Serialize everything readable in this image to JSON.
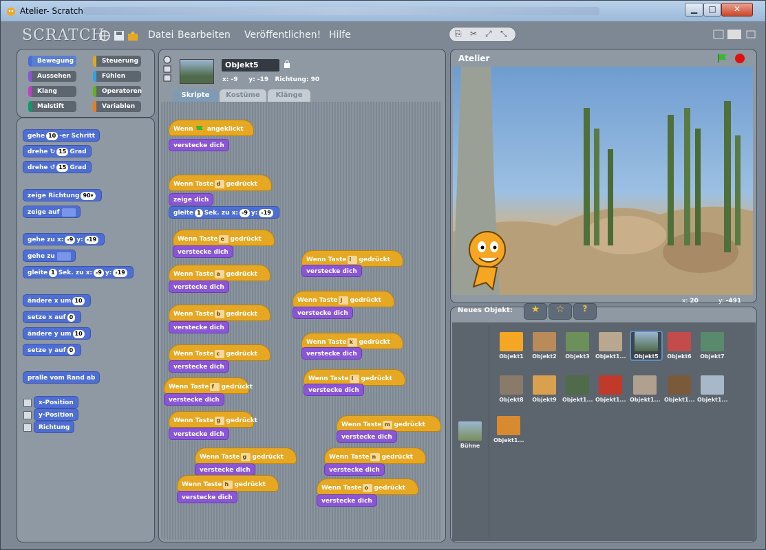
{
  "window": {
    "title": "Atelier- Scratch",
    "buttons": {
      "minimize": "▁",
      "maximize": "□",
      "close": "✕"
    }
  },
  "menu": {
    "logo": "SCRATCH",
    "items": [
      "Datei",
      "Bearbeiten",
      "Veröffentlichen!",
      "Hilfe"
    ]
  },
  "categories": [
    {
      "label": "Bewegung",
      "color": "#4a6cd4",
      "active": true
    },
    {
      "label": "Steuerung",
      "color": "#e1a91a"
    },
    {
      "label": "Aussehen",
      "color": "#8a55d7"
    },
    {
      "label": "Fühlen",
      "color": "#2ca5e2"
    },
    {
      "label": "Klang",
      "color": "#bb42c3"
    },
    {
      "label": "Operatoren",
      "color": "#5cb712"
    },
    {
      "label": "Malstift",
      "color": "#0e9a6c"
    },
    {
      "label": "Variablen",
      "color": "#ee7d16"
    }
  ],
  "palette": {
    "gehe": {
      "pre": "gehe",
      "val": "10",
      "post": "-er Schritt"
    },
    "drehe_r": {
      "pre": "drehe",
      "icon": "↻",
      "val": "15",
      "post": "Grad"
    },
    "drehe_l": {
      "pre": "drehe",
      "icon": "↺",
      "val": "15",
      "post": "Grad"
    },
    "zeige_richtung": {
      "pre": "zeige Richtung",
      "val": "90▾"
    },
    "zeige_auf": {
      "pre": "zeige auf"
    },
    "gehe_zu_xy": {
      "pre": "gehe zu x:",
      "x": "-9",
      "mid": "y:",
      "y": "-19"
    },
    "gehe_zu": {
      "pre": "gehe zu"
    },
    "gleite": {
      "pre": "gleite",
      "val": "1",
      "mid": "Sek. zu x:",
      "x": "-9",
      "mid2": "y:",
      "y": "-19"
    },
    "aendere_x": {
      "pre": "ändere x um",
      "val": "10"
    },
    "setze_x": {
      "pre": "setze x auf",
      "val": "0"
    },
    "aendere_y": {
      "pre": "ändere y um",
      "val": "10"
    },
    "setze_y": {
      "pre": "setze y auf",
      "val": "0"
    },
    "pralle": "pralle vom Rand ab",
    "reporters": [
      "x-Position",
      "y-Position",
      "Richtung"
    ]
  },
  "sprite": {
    "name": "Objekt5",
    "x_label": "x:",
    "x": "-9",
    "y_label": "y:",
    "y": "-19",
    "dir_label": "Richtung:",
    "dir": "90"
  },
  "tabs": [
    "Skripte",
    "Kostüme",
    "Klänge"
  ],
  "scripts": {
    "flag_hat": {
      "pre": "Wenn",
      "post": "angeklickt"
    },
    "key_pre": "Wenn Taste",
    "key_post": "gedrückt",
    "hide": "verstecke dich",
    "show": "zeige dich",
    "glide": {
      "pre": "gleite",
      "val": "1",
      "mid": "Sek. zu x:",
      "x": "-9",
      "mid2": "y:",
      "y": "-19"
    },
    "keys": [
      "d",
      "e",
      "a",
      "b",
      "c",
      "f",
      "g",
      "g",
      "h",
      "i",
      "j",
      "k",
      "l",
      "m",
      "n",
      "o"
    ]
  },
  "stage": {
    "title": "Atelier",
    "mouse_x_label": "x:",
    "mouse_x": "20",
    "mouse_y_label": "y:",
    "mouse_y": "-491"
  },
  "sprites": {
    "new_label": "Neues Objekt:",
    "stage_label": "Bühne",
    "items": [
      "Objekt1",
      "Objekt2",
      "Objekt3",
      "Objekt1...",
      "Objekt5",
      "Objekt6",
      "Objekt7",
      "Objekt8",
      "Objekt9",
      "Objekt1...",
      "Objekt1...",
      "Objekt1...",
      "Objekt1...",
      "Objekt1...",
      "Objekt1..."
    ]
  }
}
